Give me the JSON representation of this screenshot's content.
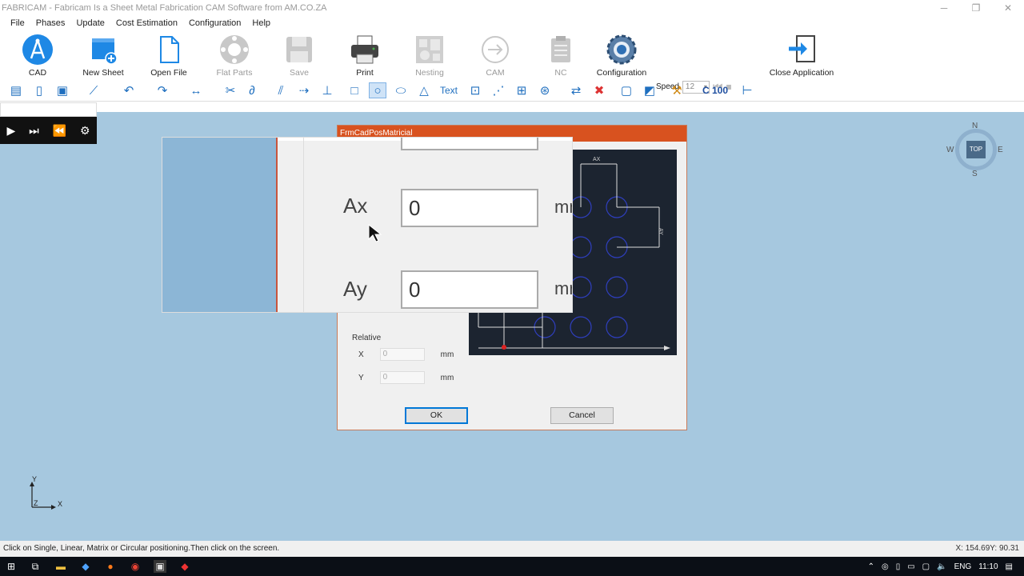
{
  "window": {
    "title": "FABRICAM - Fabricam Is a Sheet Metal Fabrication CAM Software from AM.CO.ZA",
    "minimize_glyph": "─",
    "restore_glyph": "❐",
    "close_glyph": "✕"
  },
  "menu": [
    "File",
    "Phases",
    "Update",
    "Cost Estimation",
    "Configuration",
    "Help"
  ],
  "toolbar": {
    "cad": "CAD",
    "new_sheet": "New Sheet",
    "open_file": "Open File",
    "flat_parts": "Flat Parts",
    "save": "Save",
    "print": "Print",
    "nesting": "Nesting",
    "cam": "CAM",
    "nc": "NC",
    "configuration": "Configuration",
    "speed_label": "Speed",
    "speed_value": "12",
    "close_application": "Close Application"
  },
  "draw_toolbar": {
    "text_tool": "Text",
    "c100": "C 100"
  },
  "compass": {
    "n": "N",
    "s": "S",
    "e": "E",
    "w": "W",
    "top": "TOP"
  },
  "axes": {
    "x": "X",
    "y": "Y",
    "z": "Z"
  },
  "dialog": {
    "title": "FrmCadPosMatricial",
    "relative_label": "Relative",
    "x_label": "X",
    "y_label": "Y",
    "x_value": "0",
    "y_value": "0",
    "unit": "mm",
    "ok": "OK",
    "cancel": "Cancel",
    "preview_ax": "AX",
    "preview_ay": "AY"
  },
  "zoom": {
    "ax_label": "Ax",
    "ay_label": "Ay",
    "ax_value": "0",
    "ay_value": "0",
    "unit": "mm"
  },
  "status": {
    "hint": "Click on Single, Linear, Matrix or Circular positioning.Then click on the screen.",
    "coords": "X: 154.69Y: 90.31"
  },
  "taskbar": {
    "language": "ENG",
    "time": "11:10"
  },
  "colors": {
    "canvas": "#a6c8df",
    "dialog_titlebar": "#d8521f",
    "accent_blue": "#1f6fbf"
  }
}
